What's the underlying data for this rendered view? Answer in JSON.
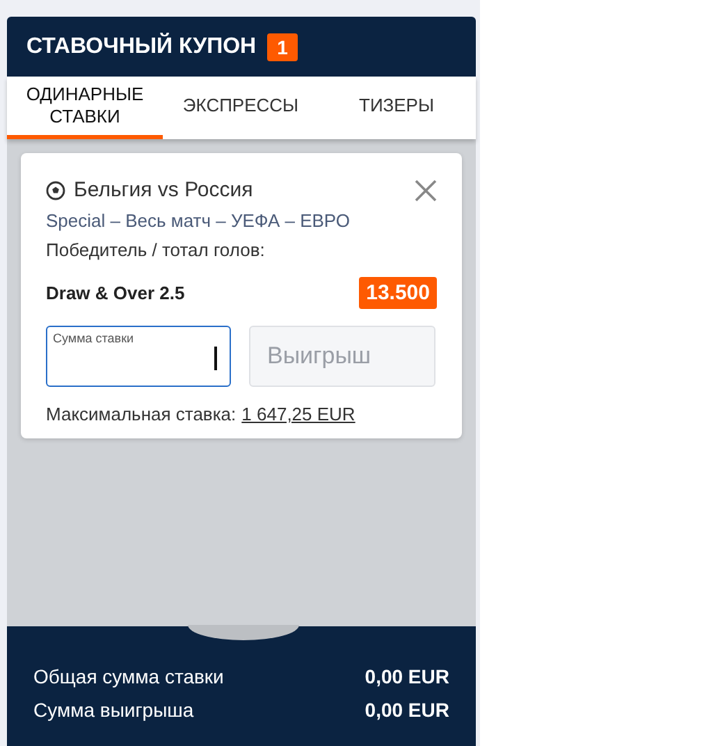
{
  "coupon": {
    "title": "СТАВОЧНЫЙ КУПОН",
    "count": "1"
  },
  "tabs": [
    {
      "label": "ОДИНАРНЫЕ СТАВКИ",
      "selected": true
    },
    {
      "label": "ЭКСПРЕССЫ",
      "selected": false
    },
    {
      "label": "ТИЗЕРЫ",
      "selected": false
    }
  ],
  "bet": {
    "event": "Бельгия vs Россия",
    "market_path": "Special – Весь матч – УЕФА – ЕВРО",
    "market": "Победитель / тотал голов:",
    "selection": "Draw & Over 2.5",
    "odds": "13.500",
    "stake": {
      "label": "Сумма ставки",
      "focused": true
    },
    "winnings": {
      "placeholder": "Выигрыш",
      "disabled": true
    },
    "max_label": "Максимальная ставка:",
    "max_value": "1 647,25 EUR"
  },
  "totals": [
    {
      "label": "Общая сумма ставки",
      "value": "0,00 EUR"
    },
    {
      "label": "Сумма выигрыша",
      "value": "0,00 EUR"
    }
  ]
}
